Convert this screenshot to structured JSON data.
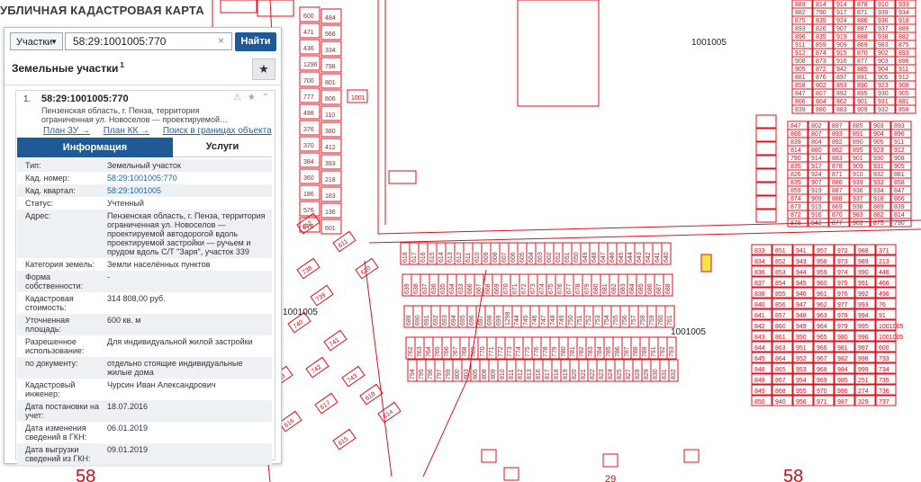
{
  "map": {
    "title": "УБЛИЧНАЯ КАДАСТРОВАЯ КАРТА",
    "quarter_labels": [
      "1001005",
      "1001005",
      "1001005"
    ],
    "big_labels": [
      "58",
      "58",
      "29"
    ],
    "parcel_labels": {
      "top": [
        "600",
        "484",
        "471",
        "566",
        "436",
        "334",
        "1296",
        "798",
        "700",
        "801",
        "777",
        "806",
        "498",
        "110",
        "376",
        "380",
        "370",
        "412",
        "384",
        "393",
        "360",
        "218",
        "186",
        "183",
        "576",
        "136",
        "576",
        "601",
        "1001"
      ],
      "grid_right": [
        "889",
        "882",
        "875",
        "893",
        "896",
        "911",
        "912",
        "908",
        "905",
        "881",
        "858",
        "847",
        "866",
        "839",
        "814",
        "790",
        "835",
        "826",
        "835",
        "859",
        "874",
        "873",
        "872",
        "876",
        "802",
        "807",
        "804",
        "880",
        "914",
        "917",
        "924",
        "907",
        "919",
        "909",
        "915",
        "916",
        "942",
        "897",
        "893",
        "892",
        "862",
        "883",
        "878",
        "871",
        "886",
        "887",
        "888",
        "869",
        "870",
        "877",
        "885",
        "891",
        "890",
        "895",
        "901",
        "909",
        "910",
        "939",
        "936",
        "937",
        "938",
        "983",
        "902",
        "903",
        "904",
        "905",
        "923",
        "930",
        "931",
        "932",
        "933",
        "934",
        "918"
      ],
      "lower": [
        "618",
        "617",
        "616",
        "615",
        "614",
        "613",
        "612",
        "611",
        "610",
        "609",
        "608",
        "607",
        "606",
        "605",
        "604",
        "603",
        "602",
        "652",
        "651",
        "650",
        "649",
        "648",
        "647",
        "646",
        "645",
        "644",
        "643",
        "642",
        "641",
        "640",
        "639",
        "638",
        "637",
        "636",
        "635",
        "634",
        "633",
        "666",
        "667",
        "668",
        "669",
        "670",
        "671",
        "672",
        "673",
        "674",
        "675",
        "676",
        "677",
        "678",
        "679",
        "680",
        "681",
        "682",
        "683",
        "684",
        "685",
        "686",
        "687",
        "688",
        "689",
        "690",
        "691",
        "692",
        "693",
        "694",
        "695",
        "696",
        "697",
        "698",
        "699",
        "1298",
        "744",
        "745",
        "746",
        "747",
        "748",
        "749",
        "750",
        "751",
        "752",
        "753",
        "754",
        "755",
        "756",
        "757",
        "758",
        "759",
        "760",
        "761",
        "762",
        "763",
        "764",
        "765",
        "766",
        "767",
        "768",
        "769",
        "770",
        "771",
        "772",
        "773",
        "774",
        "775",
        "776",
        "778",
        "779",
        "780",
        "781",
        "782",
        "783",
        "784",
        "785",
        "786",
        "787",
        "788",
        "789",
        "791",
        "792",
        "793",
        "794",
        "795",
        "796",
        "797",
        "799",
        "800",
        "803",
        "805",
        "808",
        "809",
        "810",
        "811",
        "812",
        "813",
        "816",
        "817",
        "818",
        "819",
        "820",
        "821",
        "822",
        "823",
        "824",
        "825",
        "827",
        "828",
        "829",
        "830",
        "831",
        "832",
        "833",
        "834",
        "836",
        "837",
        "838",
        "840",
        "841",
        "842",
        "843",
        "844",
        "845",
        "846",
        "848",
        "849",
        "850",
        "851",
        "852",
        "853",
        "854",
        "855",
        "856",
        "857",
        "860",
        "861",
        "863",
        "864",
        "865",
        "867",
        "868",
        "940",
        "941",
        "943",
        "944",
        "945",
        "946",
        "947",
        "948",
        "949",
        "950",
        "951",
        "952",
        "953",
        "954",
        "955",
        "956",
        "957",
        "958",
        "959",
        "960",
        "961",
        "962",
        "963",
        "964",
        "965",
        "966",
        "967",
        "968",
        "969",
        "970",
        "971",
        "972",
        "973",
        "974",
        "975",
        "976",
        "977",
        "978",
        "979",
        "980",
        "981",
        "982",
        "984",
        "985",
        "986",
        "987",
        "988",
        "989",
        "990",
        "991",
        "992",
        "993",
        "994",
        "995",
        "996",
        "997",
        "998",
        "999",
        "251",
        "274",
        "329",
        "371",
        "213",
        "446",
        "466",
        "496",
        "76",
        "91",
        "1001005",
        "1001005",
        "600",
        "733",
        "734",
        "735",
        "736",
        "737",
        "738",
        "739",
        "740",
        "741",
        "742",
        "743"
      ]
    },
    "colors": {
      "parcel": "#e0101c",
      "highlight": "#f7e24a",
      "background": "#ffffff"
    }
  },
  "search": {
    "category": "Участки",
    "query": "58:29:1001005:770",
    "find_label": "Найти"
  },
  "panel": {
    "title": "Земельные участки",
    "title_sup": "1",
    "result_num": "1.",
    "cadastral": "58:29:1001005:770",
    "address_short": "Пензенская область, г. Пенза, территория ограниченная ул. Новоселов — проектируемой…",
    "links": [
      "План ЗУ →",
      "План КК →",
      "Поиск в границах объекта →"
    ],
    "tabs": [
      "Информация",
      "Услуги"
    ],
    "attributes": [
      {
        "key": "Тип:",
        "value": "Земельный участок",
        "link": false
      },
      {
        "key": "Кад. номер:",
        "value": "58:29:1001005:770",
        "link": true
      },
      {
        "key": "Кад. квартал:",
        "value": "58:29:1001005",
        "link": true
      },
      {
        "key": "Статус:",
        "value": "Учтенный",
        "link": false
      },
      {
        "key": "Адрес:",
        "value": "Пензенская область, г. Пенза, территория ограниченная ул. Новоселов — проектируемой автодорогой вдоль проектируемой застройки — ручьем и прудом вдоль С/Т \"Заря\", участок 339",
        "link": false
      },
      {
        "key": "Категория земель:",
        "value": "Земли населённых пунктов",
        "link": false
      },
      {
        "key": "Форма собственности:",
        "value": "-",
        "link": false
      },
      {
        "key": "Кадастровая стоимость:",
        "value": "314 808,00 руб.",
        "link": false
      },
      {
        "key": "Уточненная площадь:",
        "value": "600 кв. м",
        "link": false
      },
      {
        "key": "Разрешенное использование:",
        "value": "Для индивидуальной жилой застройки",
        "link": false
      },
      {
        "key": "по документу:",
        "value": "отдельно стоящие индивидуальные жилые дома",
        "link": false
      },
      {
        "key": "Кадастровый инженер:",
        "value": "Чурсин Иван Александрович",
        "link": false
      },
      {
        "key": "Дата постановки на учет:",
        "value": "18.07.2016",
        "link": false
      },
      {
        "key": "Дата изменения сведений в ГКН:",
        "value": "06.01.2019",
        "link": false
      },
      {
        "key": "Дата выгрузки сведений из ГКН:",
        "value": "09.01.2019",
        "link": false
      }
    ]
  },
  "icons": {
    "star": "star-icon",
    "dropdown": "chevron-down-icon",
    "clear": "close-icon",
    "tools": "warning-icon"
  }
}
